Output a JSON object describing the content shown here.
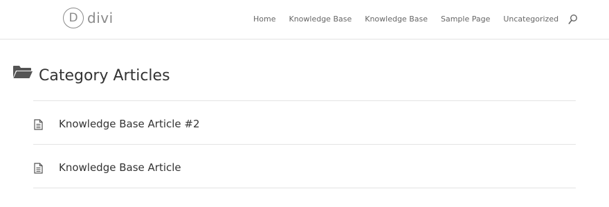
{
  "site": {
    "logo_mark": "D",
    "logo_text": "divi"
  },
  "nav": {
    "items": [
      {
        "label": "Home"
      },
      {
        "label": "Knowledge Base"
      },
      {
        "label": "Knowledge Base"
      },
      {
        "label": "Sample Page"
      },
      {
        "label": "Uncategorized"
      }
    ],
    "search_icon": "search-icon"
  },
  "page": {
    "title": "Category Articles",
    "title_icon": "folder-open-icon"
  },
  "articles": [
    {
      "title": "Knowledge Base Article #2",
      "icon": "document-icon"
    },
    {
      "title": "Knowledge Base Article",
      "icon": "document-icon"
    }
  ],
  "colors": {
    "text": "#333333",
    "nav_text": "#666666",
    "logo": "#8a8a8a",
    "divider": "#e4e4e4",
    "icon": "#555555"
  }
}
